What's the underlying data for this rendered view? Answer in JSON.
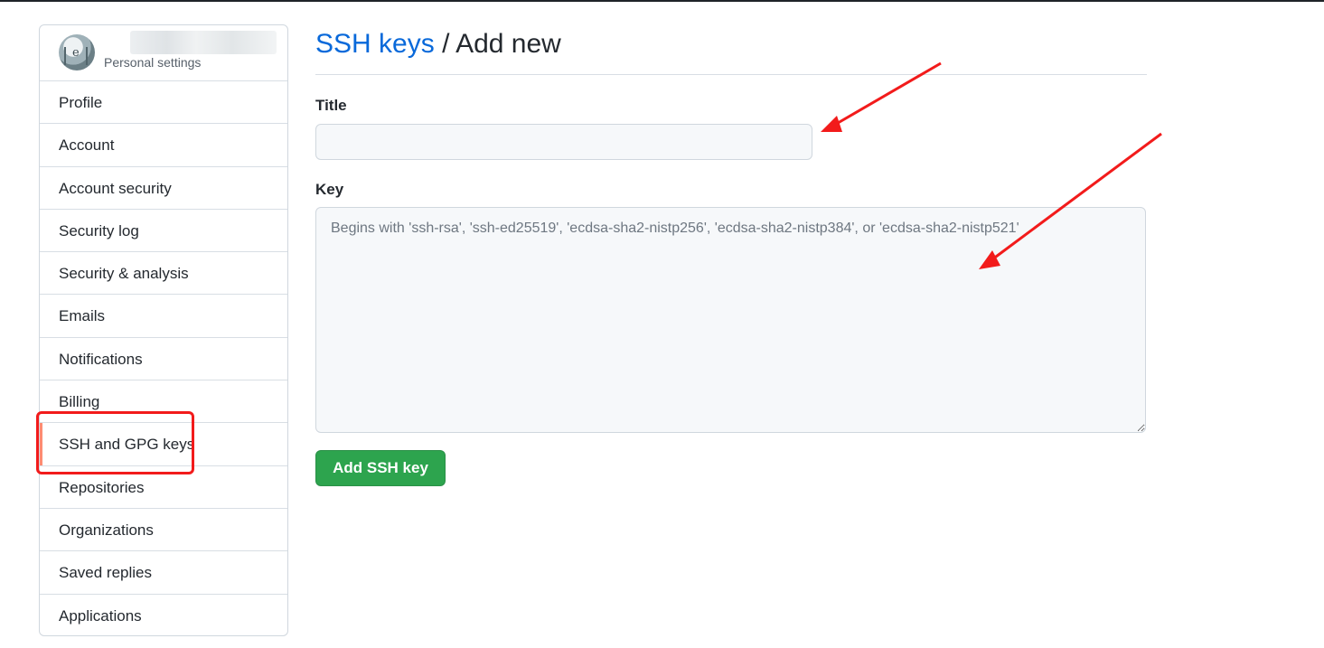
{
  "sidebar": {
    "header_subtitle": "Personal settings",
    "items": [
      {
        "label": "Profile"
      },
      {
        "label": "Account"
      },
      {
        "label": "Account security"
      },
      {
        "label": "Security log"
      },
      {
        "label": "Security & analysis"
      },
      {
        "label": "Emails"
      },
      {
        "label": "Notifications"
      },
      {
        "label": "Billing"
      },
      {
        "label": "SSH and GPG keys",
        "active": true
      },
      {
        "label": "Repositories"
      },
      {
        "label": "Organizations"
      },
      {
        "label": "Saved replies"
      },
      {
        "label": "Applications"
      }
    ]
  },
  "main": {
    "breadcrumb_link": "SSH keys",
    "breadcrumb_separator": "/",
    "page_title": "Add new",
    "title_label": "Title",
    "title_value": "",
    "key_label": "Key",
    "key_placeholder": "Begins with 'ssh-rsa', 'ssh-ed25519', 'ecdsa-sha2-nistp256', 'ecdsa-sha2-nistp384', or 'ecdsa-sha2-nistp521'",
    "submit_label": "Add SSH key"
  },
  "colors": {
    "link": "#0969da",
    "primary_button": "#2da44e",
    "active_indicator": "#fd8c73",
    "annotation": "#f21b1b"
  },
  "icons": {
    "avatar": "user-avatar",
    "annotation_arrow": "red-arrow"
  }
}
